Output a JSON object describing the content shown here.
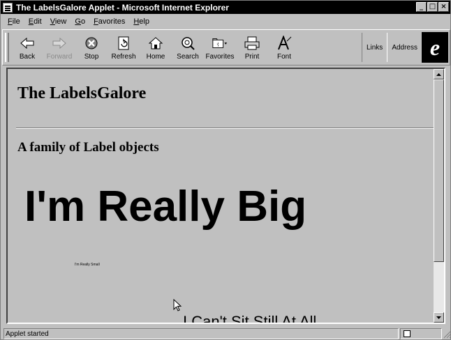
{
  "window": {
    "title": "The LabelsGalore Applet - Microsoft Internet Explorer",
    "controls": {
      "minimize": "_",
      "maximize": "□",
      "close": "×"
    }
  },
  "menu": [
    "File",
    "Edit",
    "View",
    "Go",
    "Favorites",
    "Help"
  ],
  "toolbar": {
    "back": "Back",
    "forward": "Forward",
    "stop": "Stop",
    "refresh": "Refresh",
    "home": "Home",
    "search": "Search",
    "favorites": "Favorites",
    "print": "Print",
    "font": "Font",
    "links": "Links",
    "address": "Address"
  },
  "page": {
    "heading": "The LabelsGalore",
    "subheading": "A family of Label objects",
    "label_big": "I'm Really Big",
    "label_small": "I'm Really Small",
    "label_moving": "I Can't Sit Still At All"
  },
  "status": {
    "text": "Applet started"
  },
  "colors": {
    "chrome": "#c0c0c0",
    "titlebar": "#000000"
  }
}
